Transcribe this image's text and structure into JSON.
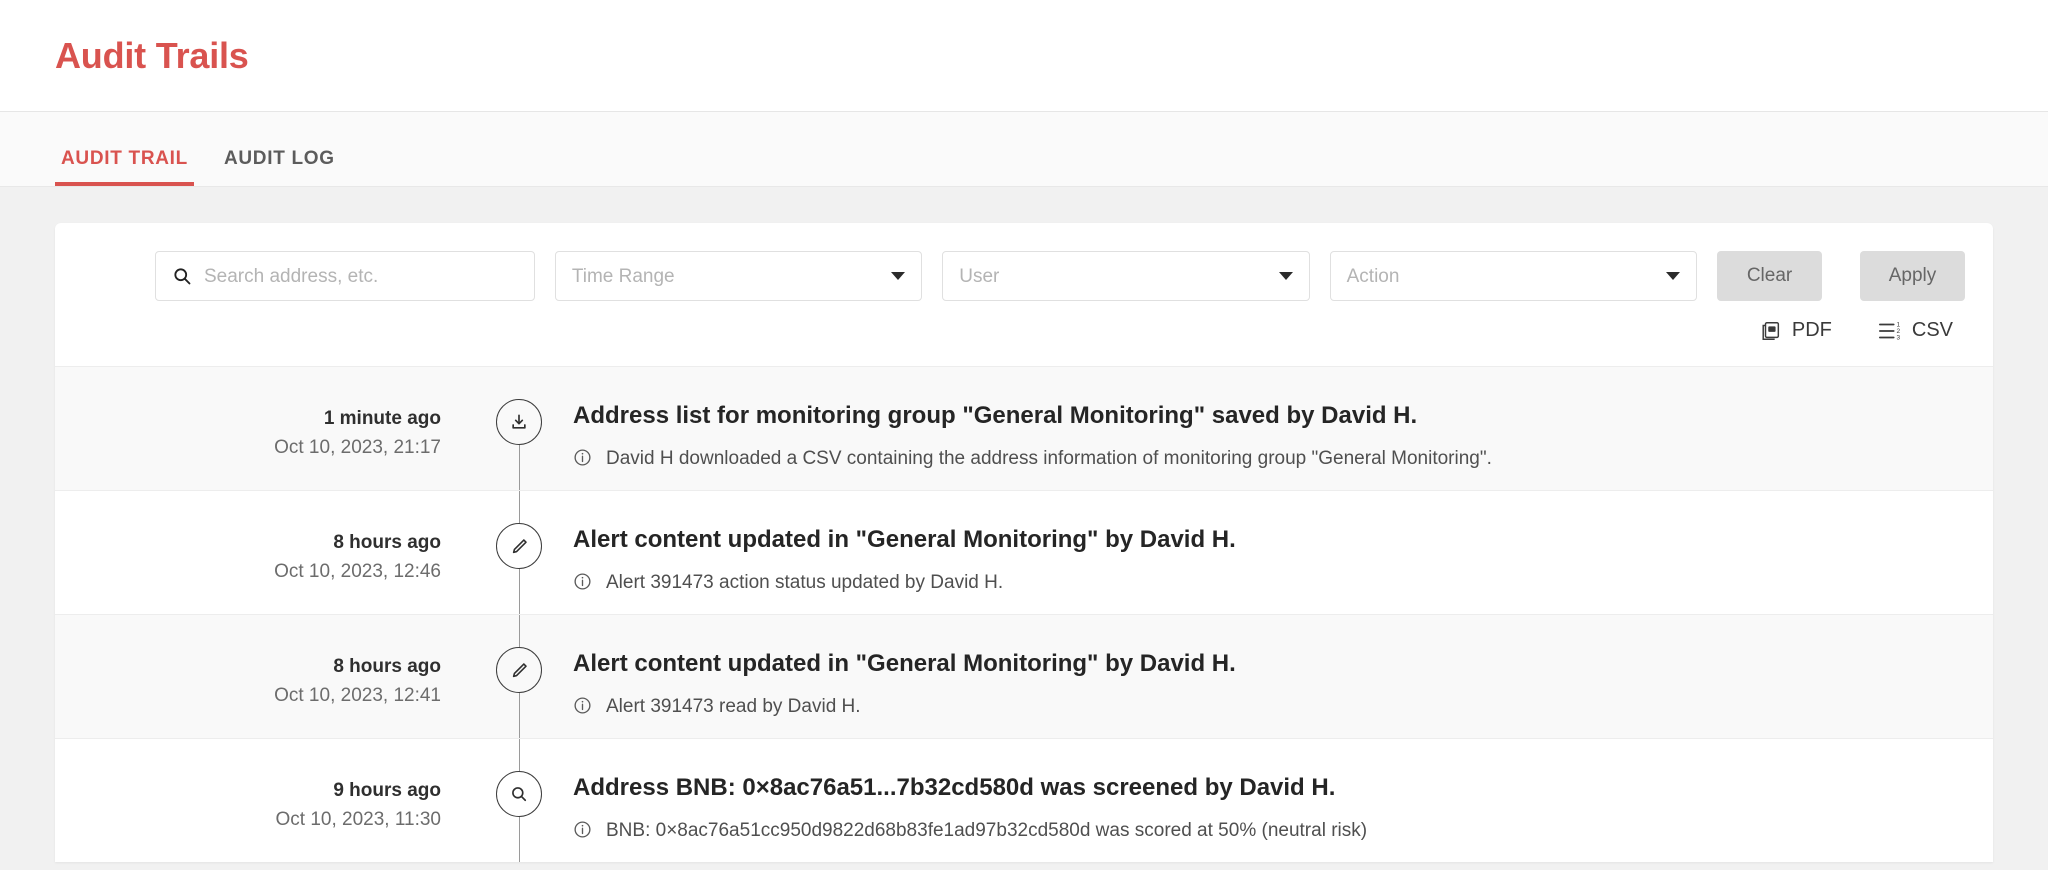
{
  "header": {
    "title": "Audit Trails"
  },
  "tabs": [
    {
      "label": "AUDIT TRAIL",
      "active": true
    },
    {
      "label": "AUDIT LOG",
      "active": false
    }
  ],
  "filters": {
    "search": {
      "placeholder": "Search address, etc.",
      "value": "",
      "icon": "search-icon"
    },
    "time_range": {
      "placeholder": "Time Range",
      "value": ""
    },
    "user": {
      "placeholder": "User",
      "value": ""
    },
    "action": {
      "placeholder": "Action",
      "value": ""
    },
    "clear_label": "Clear",
    "apply_label": "Apply"
  },
  "exports": [
    {
      "label": "PDF",
      "icon": "pdf-file-icon"
    },
    {
      "label": "CSV",
      "icon": "list-numbered-icon"
    }
  ],
  "events": [
    {
      "relative_time": "1 minute ago",
      "timestamp": "Oct 10, 2023, 21:17",
      "icon": "download-icon",
      "title": "Address list for monitoring group \"General Monitoring\" saved by David H.",
      "detail": "David H downloaded a CSV containing the address information of monitoring group \"General Monitoring\"."
    },
    {
      "relative_time": "8 hours ago",
      "timestamp": "Oct 10, 2023, 12:46",
      "icon": "pencil-icon",
      "title": "Alert content updated in \"General Monitoring\" by David H.",
      "detail": "Alert 391473 action status updated by David H."
    },
    {
      "relative_time": "8 hours ago",
      "timestamp": "Oct 10, 2023, 12:41",
      "icon": "pencil-icon",
      "title": "Alert content updated in \"General Monitoring\" by David H.",
      "detail": "Alert 391473 read by David H."
    },
    {
      "relative_time": "9 hours ago",
      "timestamp": "Oct 10, 2023, 11:30",
      "icon": "magnifier-icon",
      "title": "Address BNB: 0×8ac76a51...7b32cd580d was screened by David H.",
      "detail": "BNB: 0×8ac76a51cc950d9822d68b83fe1ad97b32cd580d was scored at 50% (neutral risk)"
    }
  ],
  "colors": {
    "accent": "#d9534f",
    "page_background": "#f1f1f1",
    "card_background": "#ffffff",
    "row_shade": "#f9f9f9"
  }
}
